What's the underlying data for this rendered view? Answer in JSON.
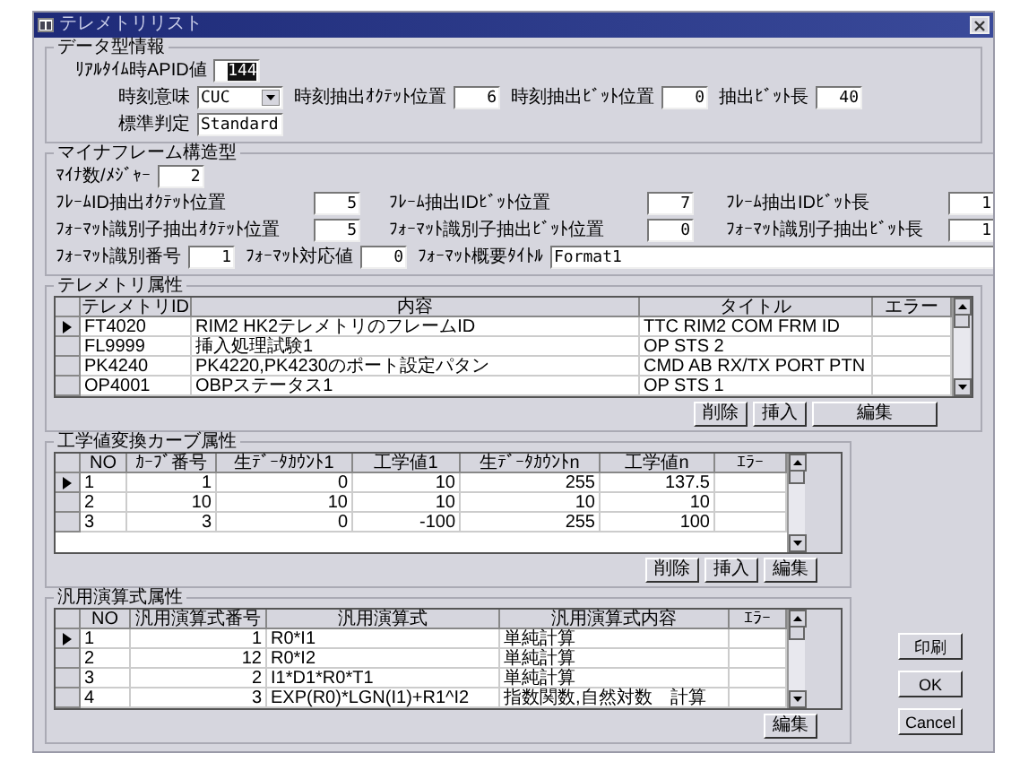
{
  "window": {
    "title": "テレメトリリスト"
  },
  "data_type": {
    "title": "データ型情報",
    "rows": [
      [
        {
          "label": "ﾘｱﾙﾀｲﾑ時APID値",
          "value": "144",
          "kind": "number",
          "highlighted": true
        }
      ],
      [
        {
          "label": "時刻意味",
          "value": "CUC",
          "kind": "dropdown",
          "highlighted": false
        },
        {
          "label": "時刻抽出ｵｸﾃｯﾄ位置",
          "value": "6",
          "kind": "number",
          "highlighted": false
        },
        {
          "label": "時刻抽出ﾋﾞｯﾄ位置",
          "value": "0",
          "kind": "number",
          "highlighted": false
        },
        {
          "label": "抽出ﾋﾞｯﾄ長",
          "value": "40",
          "kind": "number",
          "highlighted": false
        }
      ],
      [
        {
          "label": "標準判定",
          "value": "Standard",
          "kind": "text",
          "highlighted": false
        }
      ]
    ]
  },
  "minor_frame": {
    "title": "マイナフレーム構造型",
    "fields": [
      {
        "label": "ﾏｲﾅ数/ﾒｼﾞｬｰ",
        "value": "2",
        "kind": "number",
        "highlighted": false
      },
      {
        "label": "ﾌﾚｰﾑID抽出ｵｸﾃｯﾄ位置",
        "value": "5",
        "kind": "number",
        "highlighted": false
      },
      {
        "label": "ﾌﾚｰﾑ抽出IDﾋﾞｯﾄ位置",
        "value": "7",
        "kind": "number",
        "highlighted": false
      },
      {
        "label": "ﾌﾚｰﾑ抽出IDﾋﾞｯﾄ長",
        "value": "1",
        "kind": "number",
        "highlighted": false
      },
      {
        "label": "ﾌｫｰﾏｯﾄ識別子抽出ｵｸﾃｯﾄ位置",
        "value": "5",
        "kind": "number",
        "highlighted": false
      },
      {
        "label": "ﾌｫｰﾏｯﾄ識別子抽出ﾋﾞｯﾄ位置",
        "value": "0",
        "kind": "number",
        "highlighted": false
      },
      {
        "label": "ﾌｫｰﾏｯﾄ識別子抽出ﾋﾞｯﾄ長",
        "value": "1",
        "kind": "number",
        "highlighted": false
      },
      {
        "label": "ﾌｫｰﾏｯﾄ識別番号",
        "value": "1",
        "kind": "number",
        "highlighted": false
      },
      {
        "label": "ﾌｫｰﾏｯﾄ対応値",
        "value": "0",
        "kind": "number",
        "highlighted": false
      },
      {
        "label": "ﾌｫｰﾏｯﾄ概要ﾀｲﾄﾙ",
        "value": "Format1",
        "kind": "text",
        "highlighted": false
      }
    ]
  },
  "telemetry": {
    "title": "テレメトリ属性",
    "columns": [
      "テレメトリID",
      "内容",
      "タイトル",
      "エラー"
    ],
    "rows": [
      {
        "selected": true,
        "cells": [
          "FT4020",
          "RIM2 HK2テレメトリのフレームID",
          "TTC RIM2 COM FRM ID",
          ""
        ]
      },
      {
        "selected": false,
        "cells": [
          "FL9999",
          "挿入処理試験1",
          "OP STS 2",
          ""
        ]
      },
      {
        "selected": false,
        "cells": [
          "PK4240",
          "PK4220,PK4230のポート設定パタン",
          "CMD AB RX/TX PORT PTN",
          ""
        ]
      },
      {
        "selected": false,
        "cells": [
          "OP4001",
          "OBPステータス1",
          "OP STS 1",
          ""
        ]
      }
    ],
    "buttons": [
      "削除",
      "挿入",
      "編集"
    ]
  },
  "curve": {
    "title": "工学値変換カーブ属性",
    "columns": [
      "NO",
      "ｶｰﾌﾞ番号",
      "生ﾃﾞｰﾀｶｳﾝﾄ1",
      "工学値1",
      "生ﾃﾞｰﾀｶｳﾝﾄn",
      "工学値n",
      "ｴﾗｰ"
    ],
    "rows": [
      {
        "selected": true,
        "cells": [
          "1",
          "1",
          "0",
          "10",
          "255",
          "137.5",
          ""
        ]
      },
      {
        "selected": false,
        "cells": [
          "2",
          "10",
          "10",
          "10",
          "10",
          "10",
          ""
        ]
      },
      {
        "selected": false,
        "cells": [
          "3",
          "3",
          "0",
          "-100",
          "255",
          "100",
          ""
        ]
      }
    ],
    "buttons": [
      "削除",
      "挿入",
      "編集"
    ]
  },
  "formula": {
    "title": "汎用演算式属性",
    "columns": [
      "NO",
      "汎用演算式番号",
      "汎用演算式",
      "汎用演算式内容",
      "ｴﾗｰ"
    ],
    "rows": [
      {
        "selected": true,
        "cells": [
          "1",
          "1",
          "R0*I1",
          "単純計算",
          ""
        ]
      },
      {
        "selected": false,
        "cells": [
          "2",
          "12",
          "R0*I2",
          "単純計算",
          ""
        ]
      },
      {
        "selected": false,
        "cells": [
          "3",
          "2",
          "I1*D1*R0*T1",
          "単純計算",
          ""
        ]
      },
      {
        "selected": false,
        "cells": [
          "4",
          "3",
          "EXP(R0)*LGN(I1)+R1^I2",
          "指数関数,自然対数　計算",
          ""
        ]
      }
    ],
    "buttons": [
      "編集"
    ]
  },
  "side_buttons": [
    "印刷",
    "OK",
    "Cancel"
  ]
}
